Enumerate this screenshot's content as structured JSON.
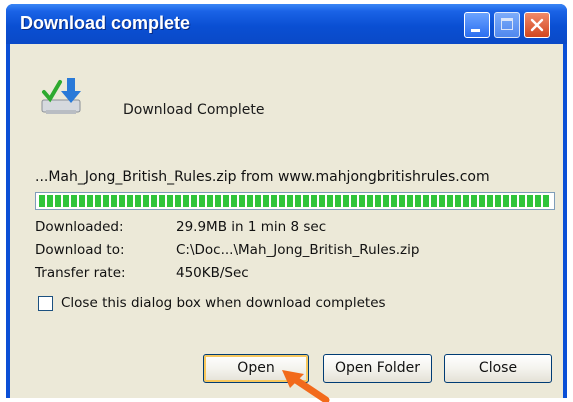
{
  "window": {
    "title": "Download complete"
  },
  "header": {
    "message": "Download Complete"
  },
  "download": {
    "source": "...Mah_Jong_British_Rules.zip from www.mahjongbritishrules.com",
    "progress_fraction": 1.0,
    "details": [
      {
        "label": "Downloaded:",
        "value": "29.9MB in 1 min 8 sec"
      },
      {
        "label": "Download to:",
        "value": "C:\\Doc...\\Mah_Jong_British_Rules.zip"
      },
      {
        "label": "Transfer rate:",
        "value": "450KB/Sec"
      }
    ]
  },
  "options": {
    "close_on_complete_label": "Close this dialog box when download completes",
    "close_on_complete_checked": false
  },
  "buttons": {
    "open": "Open",
    "open_folder": "Open Folder",
    "close": "Close"
  },
  "colors": {
    "title_bar": "#0a4fd3",
    "dialog_bg": "#ece9d8",
    "progress": "#2fc43a",
    "arrow": "#f26a1b"
  },
  "icons": {
    "download": "download-icon",
    "minimize": "minimize-icon",
    "maximize": "maximize-icon",
    "close": "close-icon",
    "pointer_arrow": "pointer-arrow-icon"
  }
}
